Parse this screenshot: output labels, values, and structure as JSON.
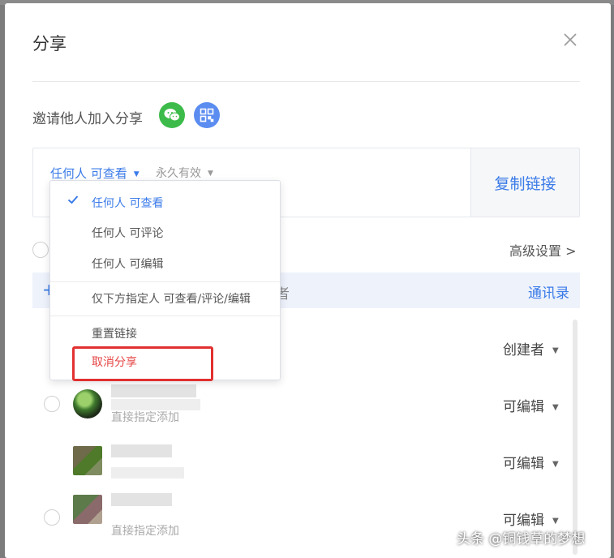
{
  "dialog": {
    "title": "分享",
    "close_icon": "close-icon"
  },
  "invite": {
    "label": "邀请他人加入分享",
    "wechat_icon": "wechat-icon",
    "qr_icon": "qr-code-icon"
  },
  "link": {
    "permission": "任何人 可查看",
    "validity": "永久有效",
    "copy_label": "复制链接"
  },
  "advanced_label": "高级设置 >",
  "contacts": {
    "placeholder_fragment": "者",
    "link_label": "通讯录"
  },
  "members": [
    {
      "role": "创建者",
      "note": ""
    },
    {
      "role": "可编辑",
      "note": "直接指定添加"
    },
    {
      "role": "可编辑",
      "note": ""
    },
    {
      "role": "可编辑",
      "note": "直接指定添加"
    }
  ],
  "dropdown": {
    "items": [
      {
        "label": "任何人 可查看",
        "selected": true
      },
      {
        "label": "任何人 可评论"
      },
      {
        "label": "任何人 可编辑"
      },
      {
        "label": "仅下方指定人 可查看/评论/编辑"
      },
      {
        "label": "重置链接"
      },
      {
        "label": "取消分享",
        "danger": true
      }
    ]
  },
  "colors": {
    "accent": "#3b7be8",
    "danger": "#e64545",
    "wechat": "#3cbb4a",
    "highlight": "#e23030"
  },
  "watermark": "头条 @铜钱草的梦想"
}
